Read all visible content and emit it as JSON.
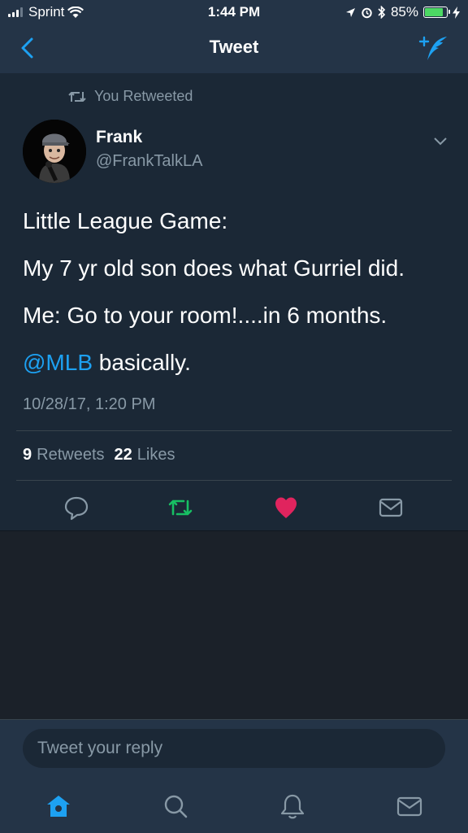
{
  "status_bar": {
    "carrier": "Sprint",
    "time": "1:44 PM",
    "battery": "85%",
    "battery_level": 0.85
  },
  "nav": {
    "title": "Tweet",
    "back_icon": "chevron-left-icon",
    "compose_icon": "compose-tweet-icon"
  },
  "tweet": {
    "retweet_label": "You Retweeted",
    "author_name": "Frank",
    "author_handle": "@FrankTalkLA",
    "lines": [
      "Little League Game:",
      "My 7 yr old son does what Gurriel did.",
      "Me: Go to your room!....in 6 months."
    ],
    "mention": "@MLB",
    "last_line_rest": " basically.",
    "timestamp": "10/28/17, 1:20 PM",
    "retweets_count": "9",
    "retweets_label": "Retweets",
    "likes_count": "22",
    "likes_label": "Likes"
  },
  "reply": {
    "placeholder": "Tweet your reply"
  },
  "tabs": [
    "home-icon",
    "search-icon",
    "notifications-icon",
    "messages-icon"
  ],
  "colors": {
    "accent": "#1da1f2",
    "retweet_active": "#17bf63",
    "like_active": "#e0245e",
    "header_bg": "#243447",
    "tweet_bg": "#1b2836",
    "muted_text": "#8899a6"
  }
}
